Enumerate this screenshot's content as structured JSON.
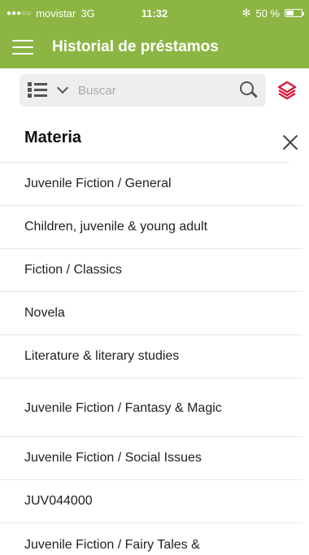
{
  "status": {
    "signal": "●●●○○",
    "carrier": "movistar",
    "network": "3G",
    "time": "11:32",
    "bluetooth": "✻",
    "battery": "50 %"
  },
  "appbar": {
    "title": "Historial de préstamos"
  },
  "search": {
    "placeholder": "Buscar"
  },
  "panel": {
    "title": "Materia",
    "items": [
      "Juvenile Fiction / General",
      "Children, juvenile & young adult",
      "Fiction / Classics",
      "Novela",
      "Literature & literary studies",
      "Juvenile Fiction / Fantasy & Magic",
      "Juvenile Fiction / Social Issues",
      "JUV044000",
      "Juvenile Fiction / Fairy Tales & Folklore"
    ]
  },
  "colors": {
    "accent": "#8db543",
    "layers_icon": "#d8193c"
  },
  "icons": {
    "menu": "hamburger-icon",
    "view": "list-view-icon",
    "search": "search-icon",
    "layers": "layers-icon",
    "close": "close-icon"
  }
}
